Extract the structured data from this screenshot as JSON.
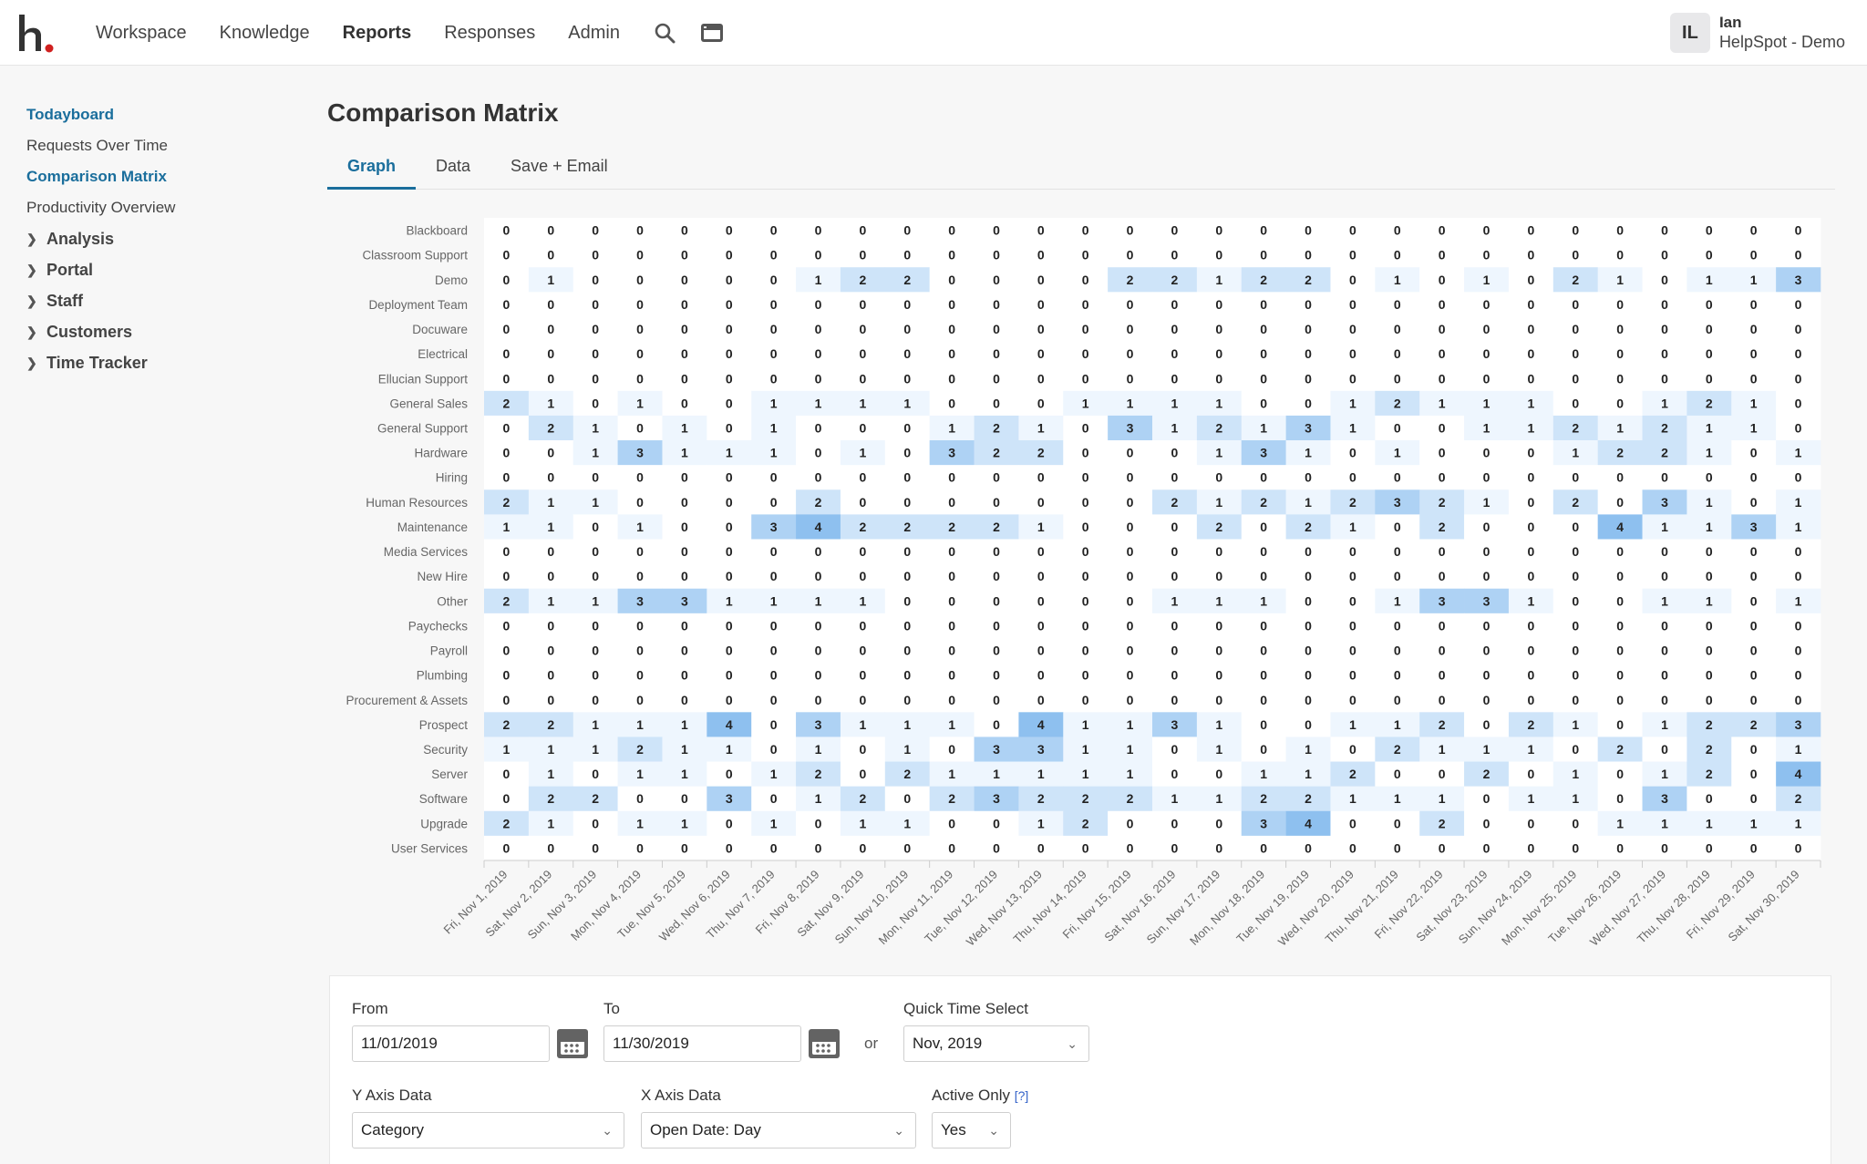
{
  "header": {
    "nav": [
      "Workspace",
      "Knowledge",
      "Reports",
      "Responses",
      "Admin"
    ],
    "active_nav": "Reports",
    "user_initials": "IL",
    "user_name": "Ian",
    "user_org": "HelpSpot - Demo"
  },
  "sidebar": {
    "links": [
      {
        "label": "Todayboard",
        "active": true
      },
      {
        "label": "Requests Over Time",
        "active": false
      },
      {
        "label": "Comparison Matrix",
        "active": true
      },
      {
        "label": "Productivity Overview",
        "active": false
      }
    ],
    "groups": [
      "Analysis",
      "Portal",
      "Staff",
      "Customers",
      "Time Tracker"
    ]
  },
  "page": {
    "title": "Comparison Matrix",
    "tabs": [
      "Graph",
      "Data",
      "Save + Email"
    ],
    "active_tab": "Graph"
  },
  "chart_data": {
    "type": "heatmap",
    "y_categories": [
      "Blackboard",
      "Classroom Support",
      "Demo",
      "Deployment Team",
      "Docuware",
      "Electrical",
      "Ellucian Support",
      "General Sales",
      "General Support",
      "Hardware",
      "Hiring",
      "Human Resources",
      "Maintenance",
      "Media Services",
      "New Hire",
      "Other",
      "Paychecks",
      "Payroll",
      "Plumbing",
      "Procurement & Assets",
      "Prospect",
      "Security",
      "Server",
      "Software",
      "Upgrade",
      "User Services"
    ],
    "x_categories": [
      "Fri, Nov 1, 2019",
      "Sat, Nov 2, 2019",
      "Sun, Nov 3, 2019",
      "Mon, Nov 4, 2019",
      "Tue, Nov 5, 2019",
      "Wed, Nov 6, 2019",
      "Thu, Nov 7, 2019",
      "Fri, Nov 8, 2019",
      "Sat, Nov 9, 2019",
      "Sun, Nov 10, 2019",
      "Mon, Nov 11, 2019",
      "Tue, Nov 12, 2019",
      "Wed, Nov 13, 2019",
      "Thu, Nov 14, 2019",
      "Fri, Nov 15, 2019",
      "Sat, Nov 16, 2019",
      "Sun, Nov 17, 2019",
      "Mon, Nov 18, 2019",
      "Tue, Nov 19, 2019",
      "Wed, Nov 20, 2019",
      "Thu, Nov 21, 2019",
      "Fri, Nov 22, 2019",
      "Sat, Nov 23, 2019",
      "Sun, Nov 24, 2019",
      "Mon, Nov 25, 2019",
      "Tue, Nov 26, 2019",
      "Wed, Nov 27, 2019",
      "Thu, Nov 28, 2019",
      "Fri, Nov 29, 2019",
      "Sat, Nov 30, 2019"
    ],
    "values": [
      [
        0,
        0,
        0,
        0,
        0,
        0,
        0,
        0,
        0,
        0,
        0,
        0,
        0,
        0,
        0,
        0,
        0,
        0,
        0,
        0,
        0,
        0,
        0,
        0,
        0,
        0,
        0,
        0,
        0,
        0
      ],
      [
        0,
        0,
        0,
        0,
        0,
        0,
        0,
        0,
        0,
        0,
        0,
        0,
        0,
        0,
        0,
        0,
        0,
        0,
        0,
        0,
        0,
        0,
        0,
        0,
        0,
        0,
        0,
        0,
        0,
        0
      ],
      [
        0,
        1,
        0,
        0,
        0,
        0,
        0,
        1,
        2,
        2,
        0,
        0,
        0,
        0,
        2,
        2,
        1,
        2,
        2,
        0,
        1,
        0,
        1,
        0,
        2,
        1,
        0,
        1,
        1,
        3
      ],
      [
        0,
        0,
        0,
        0,
        0,
        0,
        0,
        0,
        0,
        0,
        0,
        0,
        0,
        0,
        0,
        0,
        0,
        0,
        0,
        0,
        0,
        0,
        0,
        0,
        0,
        0,
        0,
        0,
        0,
        0
      ],
      [
        0,
        0,
        0,
        0,
        0,
        0,
        0,
        0,
        0,
        0,
        0,
        0,
        0,
        0,
        0,
        0,
        0,
        0,
        0,
        0,
        0,
        0,
        0,
        0,
        0,
        0,
        0,
        0,
        0,
        0
      ],
      [
        0,
        0,
        0,
        0,
        0,
        0,
        0,
        0,
        0,
        0,
        0,
        0,
        0,
        0,
        0,
        0,
        0,
        0,
        0,
        0,
        0,
        0,
        0,
        0,
        0,
        0,
        0,
        0,
        0,
        0
      ],
      [
        0,
        0,
        0,
        0,
        0,
        0,
        0,
        0,
        0,
        0,
        0,
        0,
        0,
        0,
        0,
        0,
        0,
        0,
        0,
        0,
        0,
        0,
        0,
        0,
        0,
        0,
        0,
        0,
        0,
        0
      ],
      [
        2,
        1,
        0,
        1,
        0,
        0,
        1,
        1,
        1,
        1,
        0,
        0,
        0,
        1,
        1,
        1,
        1,
        0,
        0,
        1,
        2,
        1,
        1,
        1,
        0,
        0,
        1,
        2,
        1,
        0
      ],
      [
        0,
        2,
        1,
        0,
        1,
        0,
        1,
        0,
        0,
        0,
        1,
        2,
        1,
        0,
        3,
        1,
        2,
        1,
        3,
        1,
        0,
        0,
        1,
        1,
        2,
        1,
        2,
        1,
        1,
        0
      ],
      [
        0,
        0,
        1,
        3,
        1,
        1,
        1,
        0,
        1,
        0,
        3,
        2,
        2,
        0,
        0,
        0,
        1,
        3,
        1,
        0,
        1,
        0,
        0,
        0,
        1,
        2,
        2,
        1,
        0,
        1
      ],
      [
        0,
        0,
        0,
        0,
        0,
        0,
        0,
        0,
        0,
        0,
        0,
        0,
        0,
        0,
        0,
        0,
        0,
        0,
        0,
        0,
        0,
        0,
        0,
        0,
        0,
        0,
        0,
        0,
        0,
        0
      ],
      [
        2,
        1,
        1,
        0,
        0,
        0,
        0,
        2,
        0,
        0,
        0,
        0,
        0,
        0,
        0,
        2,
        1,
        2,
        1,
        2,
        3,
        2,
        1,
        0,
        2,
        0,
        3,
        1,
        0,
        1
      ],
      [
        1,
        1,
        0,
        1,
        0,
        0,
        3,
        4,
        2,
        2,
        2,
        2,
        1,
        0,
        0,
        0,
        2,
        0,
        2,
        1,
        0,
        2,
        0,
        0,
        0,
        4,
        1,
        1,
        3,
        1
      ],
      [
        0,
        0,
        0,
        0,
        0,
        0,
        0,
        0,
        0,
        0,
        0,
        0,
        0,
        0,
        0,
        0,
        0,
        0,
        0,
        0,
        0,
        0,
        0,
        0,
        0,
        0,
        0,
        0,
        0,
        0
      ],
      [
        0,
        0,
        0,
        0,
        0,
        0,
        0,
        0,
        0,
        0,
        0,
        0,
        0,
        0,
        0,
        0,
        0,
        0,
        0,
        0,
        0,
        0,
        0,
        0,
        0,
        0,
        0,
        0,
        0,
        0
      ],
      [
        2,
        1,
        1,
        3,
        3,
        1,
        1,
        1,
        1,
        0,
        0,
        0,
        0,
        0,
        0,
        1,
        1,
        1,
        0,
        0,
        1,
        3,
        3,
        1,
        0,
        0,
        1,
        1,
        0,
        1
      ],
      [
        0,
        0,
        0,
        0,
        0,
        0,
        0,
        0,
        0,
        0,
        0,
        0,
        0,
        0,
        0,
        0,
        0,
        0,
        0,
        0,
        0,
        0,
        0,
        0,
        0,
        0,
        0,
        0,
        0,
        0
      ],
      [
        0,
        0,
        0,
        0,
        0,
        0,
        0,
        0,
        0,
        0,
        0,
        0,
        0,
        0,
        0,
        0,
        0,
        0,
        0,
        0,
        0,
        0,
        0,
        0,
        0,
        0,
        0,
        0,
        0,
        0
      ],
      [
        0,
        0,
        0,
        0,
        0,
        0,
        0,
        0,
        0,
        0,
        0,
        0,
        0,
        0,
        0,
        0,
        0,
        0,
        0,
        0,
        0,
        0,
        0,
        0,
        0,
        0,
        0,
        0,
        0,
        0
      ],
      [
        0,
        0,
        0,
        0,
        0,
        0,
        0,
        0,
        0,
        0,
        0,
        0,
        0,
        0,
        0,
        0,
        0,
        0,
        0,
        0,
        0,
        0,
        0,
        0,
        0,
        0,
        0,
        0,
        0,
        0
      ],
      [
        2,
        2,
        1,
        1,
        1,
        4,
        0,
        3,
        1,
        1,
        1,
        0,
        4,
        1,
        1,
        3,
        1,
        0,
        0,
        1,
        1,
        2,
        0,
        2,
        1,
        0,
        1,
        2,
        2,
        3
      ],
      [
        1,
        1,
        1,
        2,
        1,
        1,
        0,
        1,
        0,
        1,
        0,
        3,
        3,
        1,
        1,
        0,
        1,
        0,
        1,
        0,
        2,
        1,
        1,
        1,
        0,
        2,
        0,
        2,
        0,
        1
      ],
      [
        0,
        1,
        0,
        1,
        1,
        0,
        1,
        2,
        0,
        2,
        1,
        1,
        1,
        1,
        1,
        0,
        0,
        1,
        1,
        2,
        0,
        0,
        2,
        0,
        1,
        0,
        1,
        2,
        0,
        4
      ],
      [
        0,
        2,
        2,
        0,
        0,
        3,
        0,
        1,
        2,
        0,
        2,
        3,
        2,
        2,
        2,
        1,
        1,
        2,
        2,
        1,
        1,
        1,
        0,
        1,
        1,
        0,
        3,
        0,
        0,
        2
      ],
      [
        2,
        1,
        0,
        1,
        1,
        0,
        1,
        0,
        1,
        1,
        0,
        0,
        1,
        2,
        0,
        0,
        0,
        3,
        4,
        0,
        0,
        2,
        0,
        0,
        0,
        1,
        1,
        1,
        1,
        1
      ],
      [
        0,
        0,
        0,
        0,
        0,
        0,
        0,
        0,
        0,
        0,
        0,
        0,
        0,
        0,
        0,
        0,
        0,
        0,
        0,
        0,
        0,
        0,
        0,
        0,
        0,
        0,
        0,
        0,
        0,
        0
      ]
    ],
    "max_value": 4,
    "colors": {
      "zero": "#ffffff",
      "low": "#eef6fe",
      "high": "#8ec0ef",
      "text": "#222222",
      "label": "#666666"
    }
  },
  "filters": {
    "from_label": "From",
    "from_value": "11/01/2019",
    "to_label": "To",
    "to_value": "11/30/2019",
    "or_label": "or",
    "quick_label": "Quick Time Select",
    "quick_value": "Nov, 2019",
    "y_axis_label": "Y Axis Data",
    "y_axis_value": "Category",
    "x_axis_label": "X Axis Data",
    "x_axis_value": "Open Date: Day",
    "active_label": "Active Only",
    "active_help": "[?]",
    "active_value": "Yes"
  },
  "colors": {
    "accent": "#1a6e9c",
    "logo_dot": "#d0201f"
  }
}
